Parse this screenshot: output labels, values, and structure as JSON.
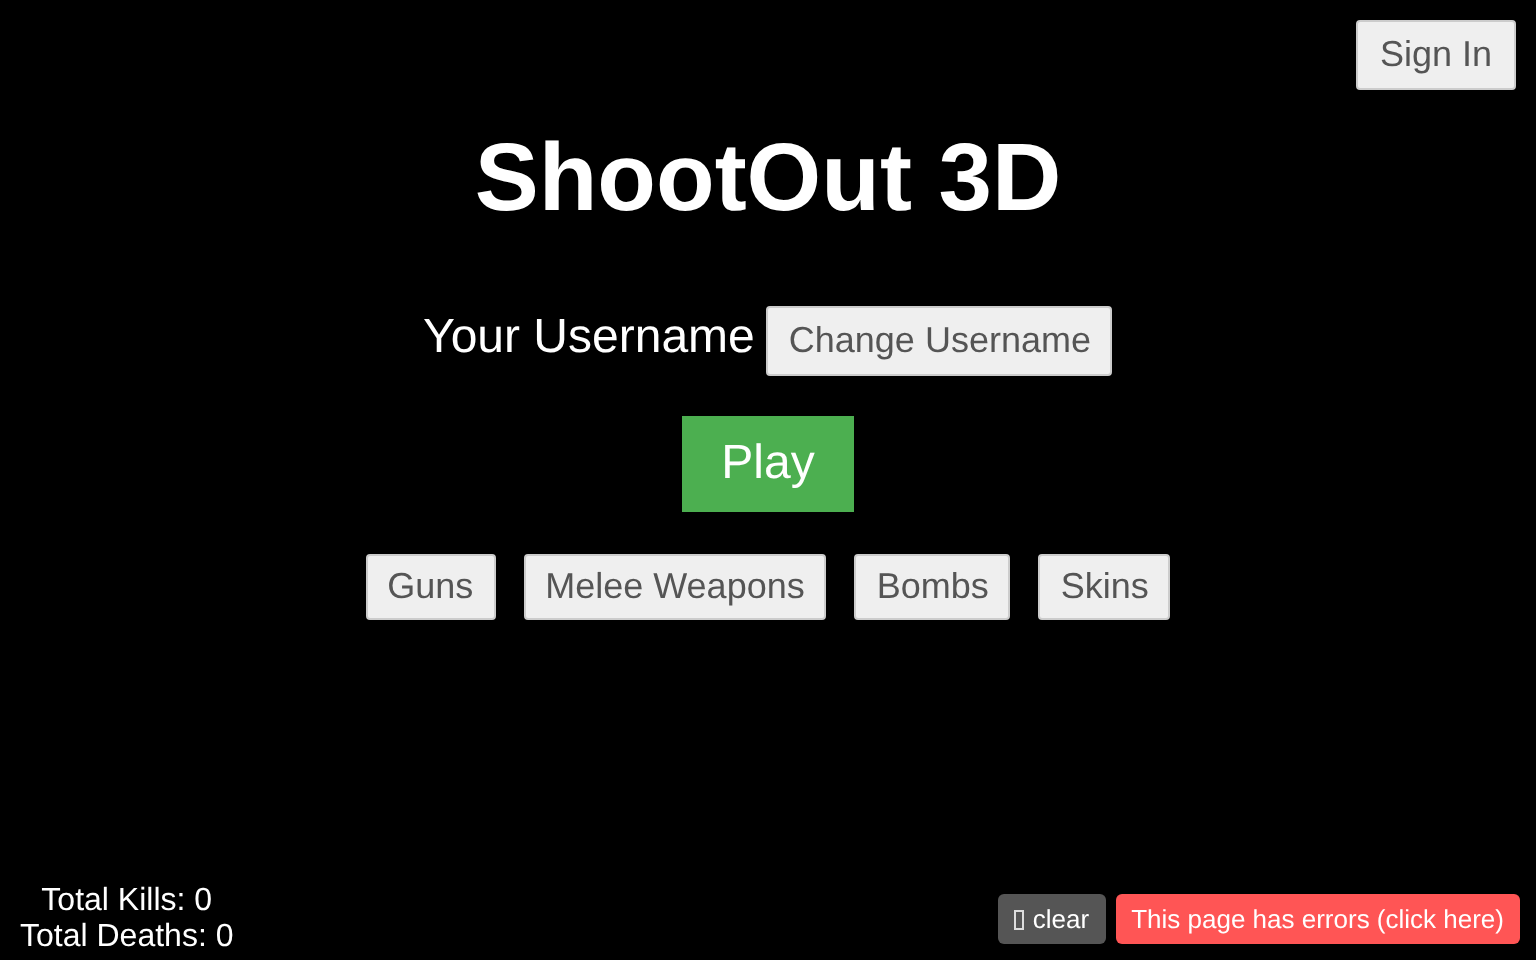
{
  "sign_in": "Sign In",
  "title": "ShootOut 3D",
  "username_label": "Your Username",
  "change_username": "Change Username",
  "play": "Play",
  "categories": [
    "Guns",
    "Melee Weapons",
    "Bombs",
    "Skins"
  ],
  "stats": [
    "Total Kills: 0",
    "Total Deaths: 0"
  ],
  "clear": "clear",
  "errors": "This page has errors (click here)"
}
